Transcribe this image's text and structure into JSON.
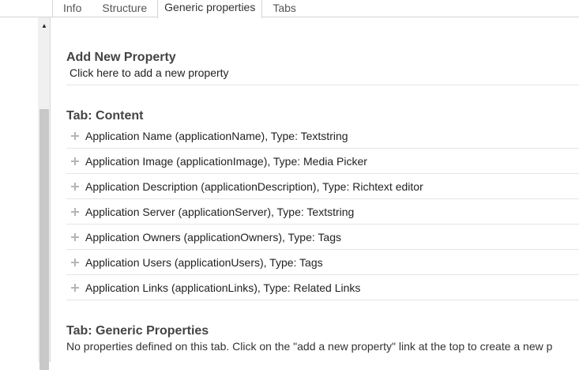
{
  "tabs": [
    {
      "label": "Info",
      "active": false
    },
    {
      "label": "Structure",
      "active": false
    },
    {
      "label": "Generic properties",
      "active": true
    },
    {
      "label": "Tabs",
      "active": false
    }
  ],
  "add_section": {
    "title": "Add New Property",
    "link": "Click here to add a new property"
  },
  "content_tab": {
    "title": "Tab: Content",
    "properties": [
      "Application Name (applicationName), Type: Textstring",
      "Application Image (applicationImage), Type: Media Picker",
      "Application Description (applicationDescription), Type: Richtext editor",
      "Application Server (applicationServer), Type: Textstring",
      "Application Owners (applicationOwners), Type: Tags",
      "Application Users (applicationUsers), Type: Tags",
      "Application Links (applicationLinks), Type: Related Links"
    ]
  },
  "generic_tab": {
    "title": "Tab: Generic Properties",
    "note": "No properties defined on this tab. Click on the \"add a new property\" link at the top to create a new p"
  },
  "icons": {
    "scroll_up": "scroll-up-arrow-icon",
    "expand": "plus-icon"
  }
}
